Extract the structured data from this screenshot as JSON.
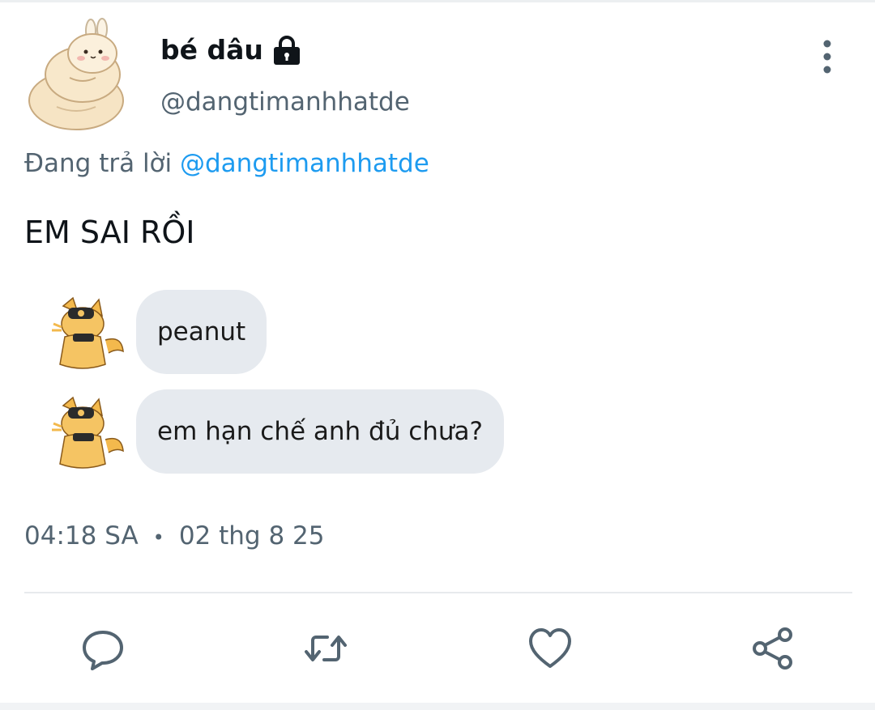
{
  "user": {
    "display_name": "bé dâu",
    "handle": "@dangtimanhhatde",
    "protected_icon": "lock-icon"
  },
  "reply": {
    "prefix": "Đang trả lời",
    "mention": "@dangtimanhhatde"
  },
  "tweet": {
    "text": "EM SAI RỒI"
  },
  "chat": [
    {
      "text": "peanut",
      "avatar_icon": "fox-sticker-avatar"
    },
    {
      "text": "em hạn chế anh đủ chưa?",
      "avatar_icon": "fox-sticker-avatar"
    }
  ],
  "meta": {
    "time": "04:18 SA",
    "date": "02 thg 8 25"
  },
  "actions": [
    "reply-icon",
    "retweet-icon",
    "like-icon",
    "share-icon"
  ],
  "colors": {
    "accent": "#1d9bf0",
    "secondary_text": "#536471",
    "bubble": "#e6eaef"
  }
}
